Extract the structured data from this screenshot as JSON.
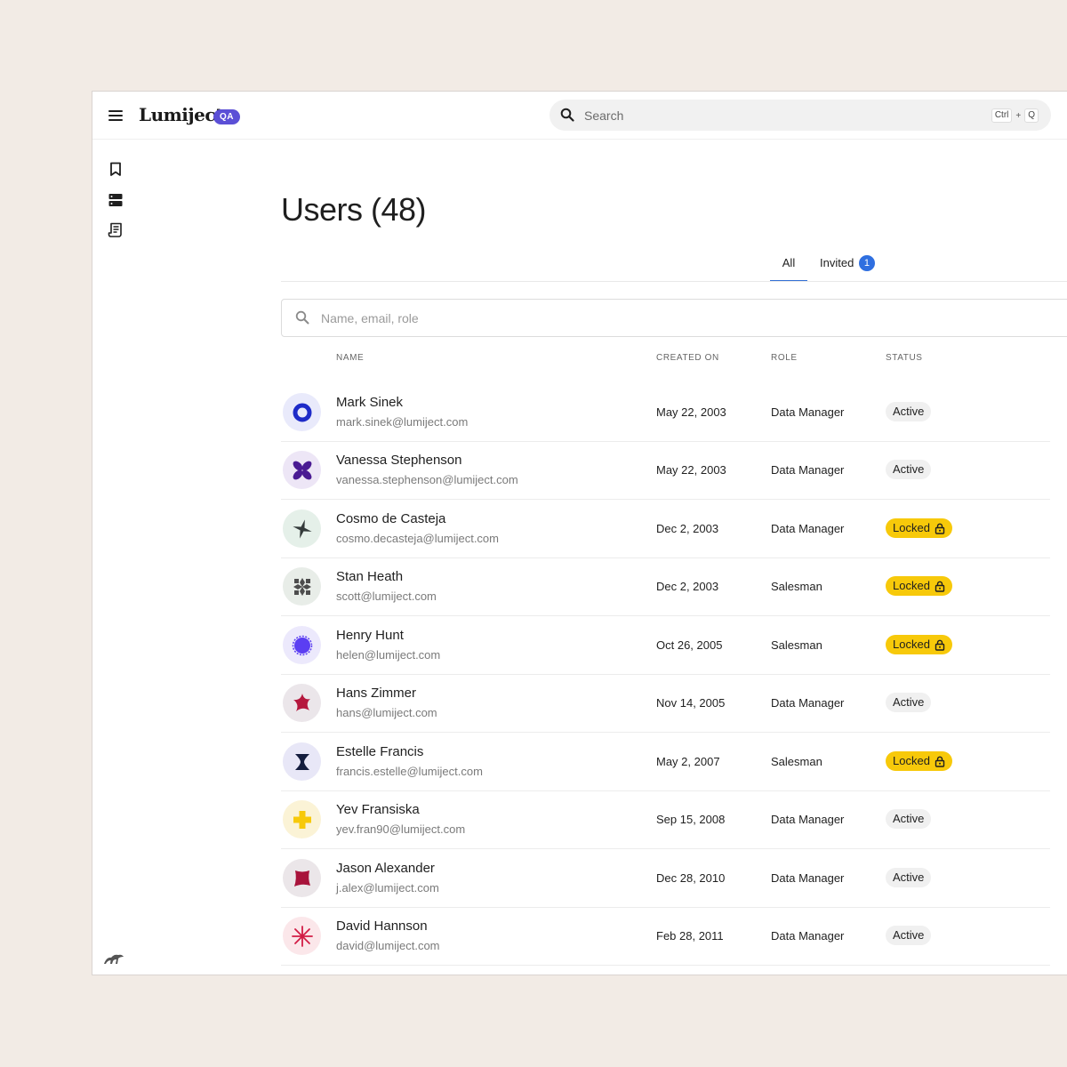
{
  "app": {
    "logo": "Lumiject",
    "badge": "QA"
  },
  "search": {
    "placeholder": "Search",
    "shortcut_key1": "Ctrl",
    "shortcut_plus": "+",
    "shortcut_key2": "Q"
  },
  "page": {
    "title": "Users (48)"
  },
  "tabs": [
    {
      "label": "All",
      "active": true
    },
    {
      "label": "Invited",
      "count": "1"
    }
  ],
  "filter": {
    "placeholder": "Name, email, role"
  },
  "table": {
    "headers": {
      "name": "NAME",
      "created": "CREATED ON",
      "role": "ROLE",
      "status": "STATUS"
    },
    "rows": [
      {
        "name": "Mark Sinek",
        "email": "mark.sinek@lumiject.com",
        "created": "May 22, 2003",
        "role": "Data Manager",
        "status": "Active",
        "avatar": "ring-icon"
      },
      {
        "name": "Vanessa Stephenson",
        "email": "vanessa.stephenson@lumiject.com",
        "created": "May 22, 2003",
        "role": "Data Manager",
        "status": "Active",
        "avatar": "butterfly-icon"
      },
      {
        "name": "Cosmo de Casteja",
        "email": "cosmo.decasteja@lumiject.com",
        "created": "Dec 2, 2003",
        "role": "Data Manager",
        "status": "Locked",
        "avatar": "sparkle-icon"
      },
      {
        "name": "Stan Heath",
        "email": "scott@lumiject.com",
        "created": "Dec 2, 2003",
        "role": "Salesman",
        "status": "Locked",
        "avatar": "pinwheel-icon"
      },
      {
        "name": "Henry Hunt",
        "email": "helen@lumiject.com",
        "created": "Oct 26, 2005",
        "role": "Salesman",
        "status": "Locked",
        "avatar": "badge-icon"
      },
      {
        "name": "Hans Zimmer",
        "email": "hans@lumiject.com",
        "created": "Nov 14, 2005",
        "role": "Data Manager",
        "status": "Active",
        "avatar": "star-icon"
      },
      {
        "name": "Estelle Francis",
        "email": "francis.estelle@lumiject.com",
        "created": "May 2, 2007",
        "role": "Salesman",
        "status": "Locked",
        "avatar": "hourglass-icon"
      },
      {
        "name": "Yev Fransiska",
        "email": "yev.fran90@lumiject.com",
        "created": "Sep 15, 2008",
        "role": "Data Manager",
        "status": "Active",
        "avatar": "cross-icon"
      },
      {
        "name": "Jason Alexander",
        "email": "j.alex@lumiject.com",
        "created": "Dec 28, 2010",
        "role": "Data Manager",
        "status": "Active",
        "avatar": "blob-icon"
      },
      {
        "name": "David Hannson",
        "email": "david@lumiject.com",
        "created": "Feb 28, 2011",
        "role": "Data Manager",
        "status": "Active",
        "avatar": "asterisk-icon"
      }
    ]
  },
  "colors": {
    "accent": "#3370d4",
    "badge": "#5b4fd6",
    "locked": "#f7c90a",
    "background": "#f2ebe5"
  },
  "icons": [
    "menu-icon",
    "search-icon",
    "bookmark-icon",
    "server-icon",
    "receipt-icon",
    "lock-icon",
    "brand-footer-icon"
  ]
}
